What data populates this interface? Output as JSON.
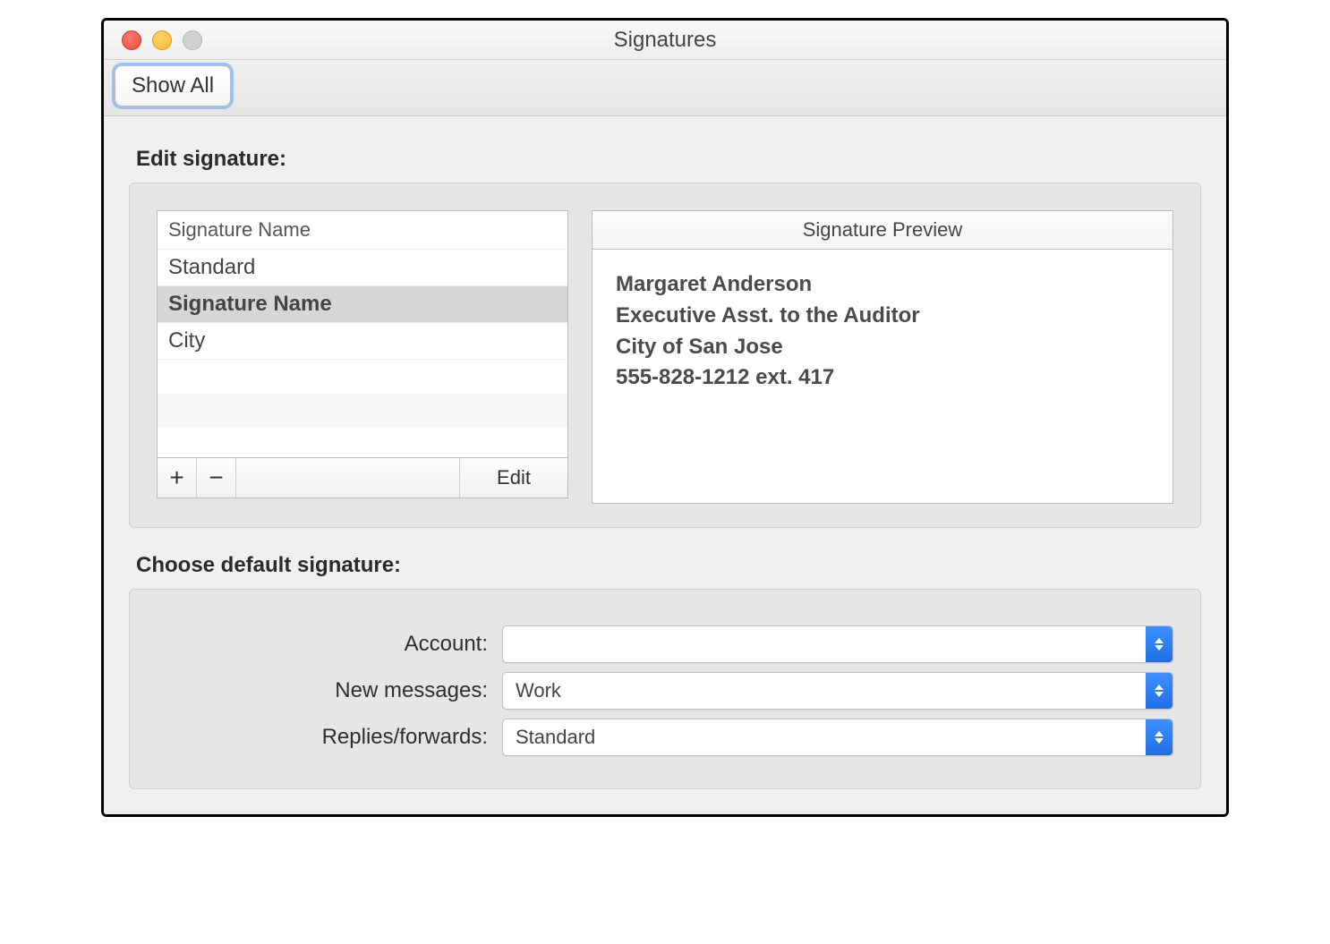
{
  "window": {
    "title": "Signatures"
  },
  "toolbar": {
    "show_all_label": "Show All"
  },
  "edit_section": {
    "heading": "Edit signature:",
    "list_header": "Signature Name",
    "signatures": [
      "Standard",
      "Signature Name",
      "City"
    ],
    "selected_index": 1,
    "add_label": "+",
    "remove_label": "−",
    "edit_button_label": "Edit",
    "preview_header": "Signature Preview",
    "preview_lines": [
      "Margaret Anderson",
      "Executive Asst. to the Auditor",
      "City of San Jose",
      "555-828-1212 ext. 417"
    ]
  },
  "defaults_section": {
    "heading": "Choose default signature:",
    "fields": {
      "account": {
        "label": "Account:",
        "value": ""
      },
      "new_messages": {
        "label": "New messages:",
        "value": "Work"
      },
      "replies_forwards": {
        "label": "Replies/forwards:",
        "value": "Standard"
      }
    }
  }
}
